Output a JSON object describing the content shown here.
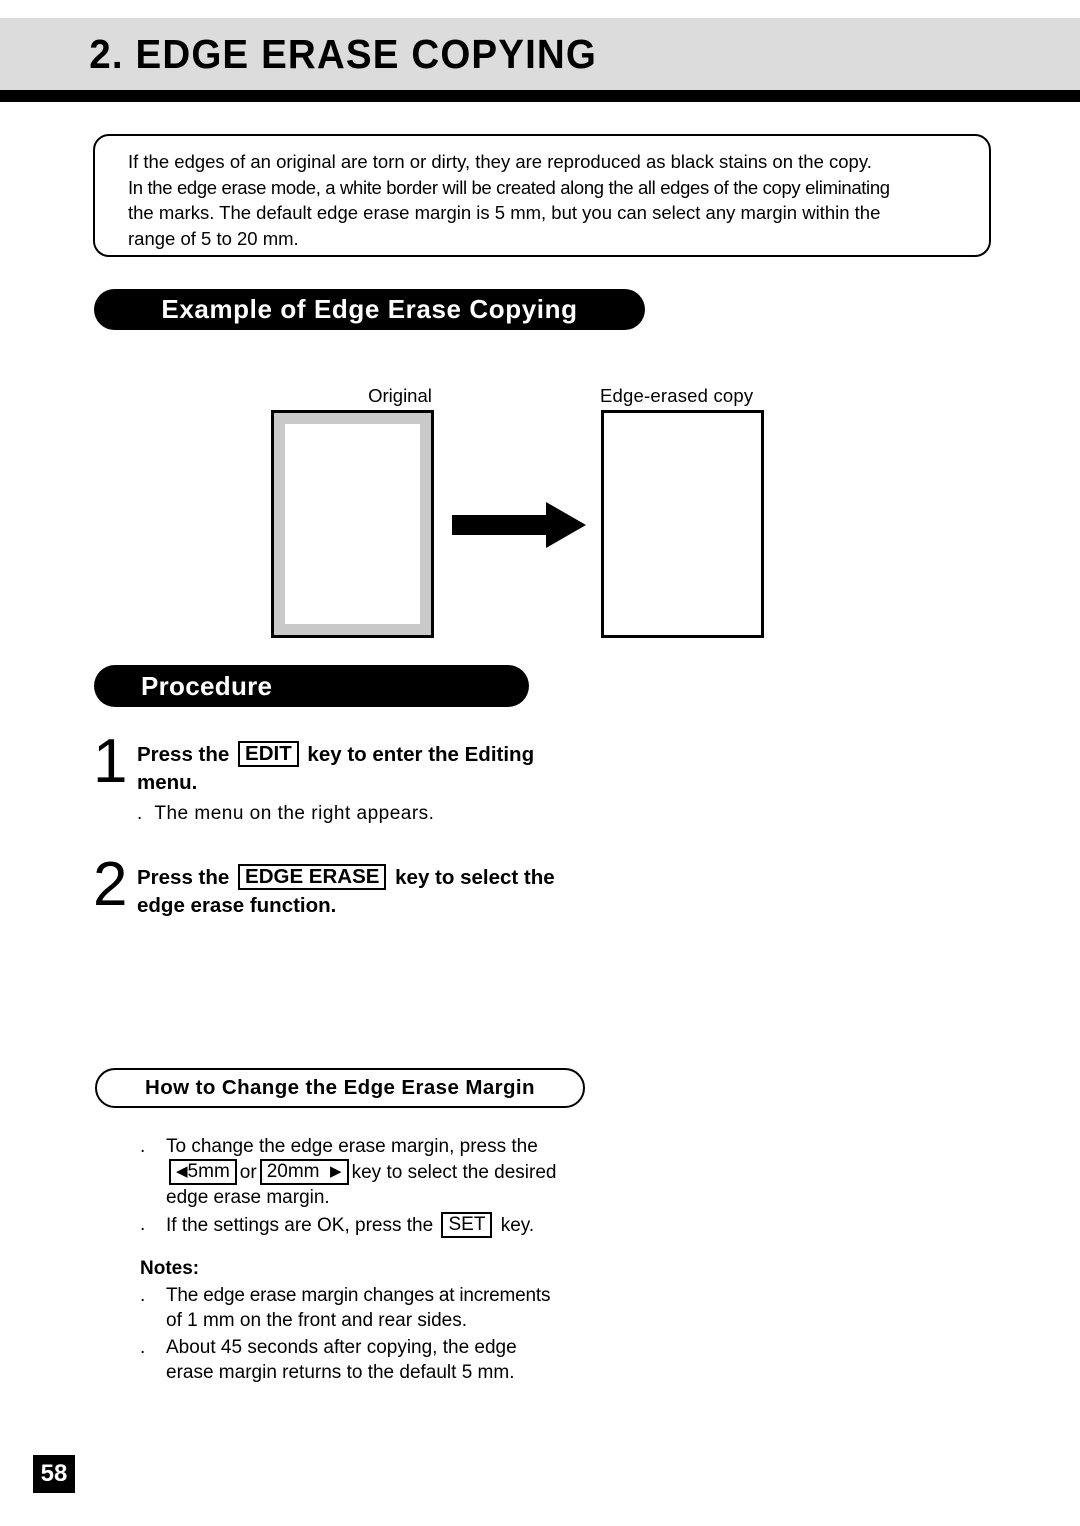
{
  "header": {
    "title": "2. EDGE ERASE COPYING"
  },
  "intro": {
    "lines": [
      "If the edges of an original are torn or dirty, they are reproduced as black stains on the copy.",
      "In the edge erase mode, a white border will be created along the all edges of the copy eliminating",
      "the marks. The default edge erase margin is 5 mm, but you can select any margin within the",
      "range of 5 to 20 mm."
    ]
  },
  "example_section": {
    "banner": "Example of Edge Erase Copying",
    "original_label": "Original",
    "copy_label": "Edge-erased copy",
    "arrow_icon": "right-arrow-icon"
  },
  "procedure_section": {
    "banner": "Procedure",
    "steps": [
      {
        "number": "1",
        "text_before_key": "Press the",
        "key": "EDIT",
        "text_after_key": "key to enter the Editing",
        "text_line2": "menu.",
        "sub_bullet": "The menu on the right appears."
      },
      {
        "number": "2",
        "text_before_key": "Press the",
        "key": "EDGE ERASE",
        "text_after_key": "key to select the",
        "text_line2": "edge erase function.",
        "sub_bullet": ""
      }
    ]
  },
  "how_to_section": {
    "banner": "How to Change the Edge Erase Margin",
    "bullets": [
      {
        "segments": [
          "To change the edge erase margin, press the",
          "key to select the desired",
          "edge erase margin."
        ],
        "keys": [
          "5mm",
          "20mm"
        ],
        "key_icons": [
          "left-triangle-icon",
          "right-triangle-icon"
        ],
        "conjunction": "or"
      },
      {
        "segments": [
          "If the settings are OK, press the",
          "key."
        ],
        "keys": [
          "SET"
        ]
      }
    ]
  },
  "notes_section": {
    "title": "Notes:",
    "items": [
      [
        "The edge erase margin changes at increments",
        "of 1 mm on the front and rear sides."
      ],
      [
        "About 45 seconds after copying, the edge",
        "erase margin returns to the default 5 mm."
      ]
    ]
  },
  "footer": {
    "page_number": "58"
  },
  "colors": {
    "header_band": "#dcdcdc",
    "rule": "#000000",
    "original_edge_gray": "#c9c9c9",
    "banner_black": "#000000"
  }
}
